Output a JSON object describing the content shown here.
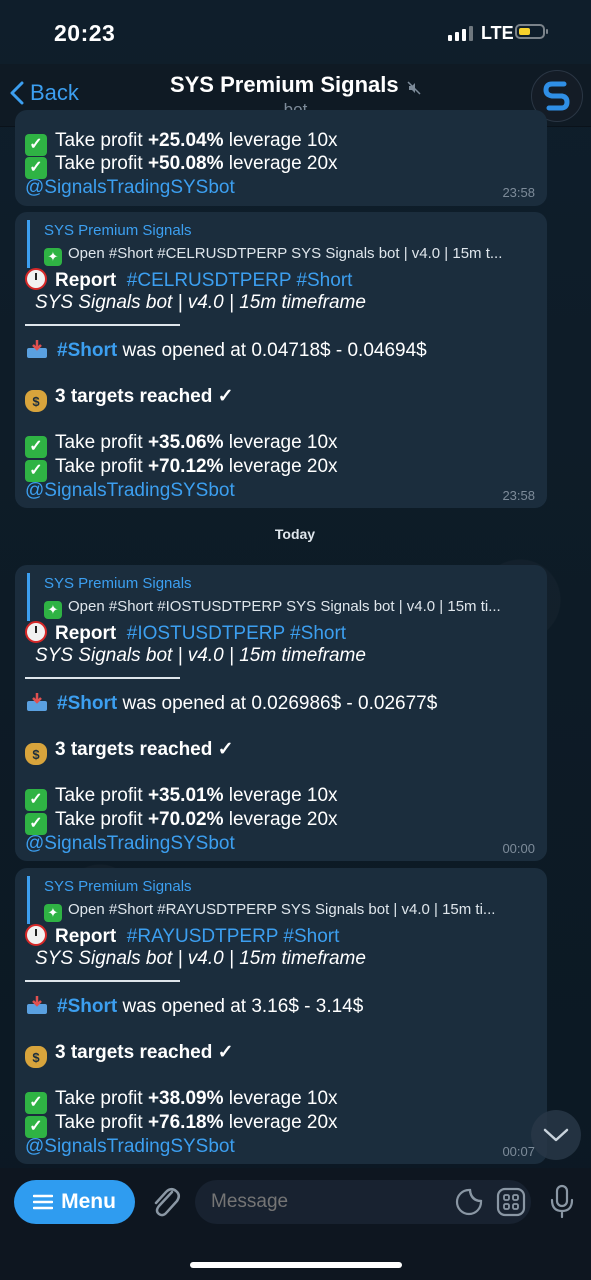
{
  "status_bar": {
    "time": "20:23",
    "network": "LTE"
  },
  "header": {
    "back_label": "Back",
    "title": "SYS Premium Signals",
    "subtitle": "bot"
  },
  "messages": [
    {
      "lines": [
        {
          "prefix": "Take profit ",
          "value": "+25.04%",
          "suffix": " leverage 10x"
        },
        {
          "prefix": "Take profit ",
          "value": "+50.08%",
          "suffix": " leverage 20x"
        }
      ],
      "mention": "@SignalsTradingSYSbot",
      "time": "23:58"
    },
    {
      "reply_name": "SYS Premium Signals",
      "reply_text": "Open #Short #CELRUSDTPERP    SYS Signals bot | v4.0 | 15m t...",
      "report_label": "Report",
      "report_tags": "#CELRUSDTPERP #Short",
      "subtitle": "SYS Signals bot | v4.0 | 15m timeframe",
      "open_tag": "#Short",
      "open_text": " was opened at 0.04718$ - 0.04694$",
      "targets": "3 targets reached ✓",
      "lines": [
        {
          "prefix": "Take profit ",
          "value": "+35.06%",
          "suffix": " leverage 10x"
        },
        {
          "prefix": "Take profit ",
          "value": "+70.12%",
          "suffix": " leverage 20x"
        }
      ],
      "mention": "@SignalsTradingSYSbot",
      "time": "23:58"
    },
    {
      "reply_name": "SYS Premium Signals",
      "reply_text": "Open #Short #IOSTUSDTPERP    SYS Signals bot | v4.0 | 15m ti...",
      "report_label": "Report",
      "report_tags": "#IOSTUSDTPERP #Short",
      "subtitle": "SYS Signals bot | v4.0 | 15m timeframe",
      "open_tag": "#Short",
      "open_text": " was opened at 0.026986$ - 0.02677$",
      "targets": "3 targets reached ✓",
      "lines": [
        {
          "prefix": "Take profit ",
          "value": "+35.01%",
          "suffix": " leverage 10x"
        },
        {
          "prefix": "Take profit ",
          "value": "+70.02%",
          "suffix": " leverage 20x"
        }
      ],
      "mention": "@SignalsTradingSYSbot",
      "time": "00:00"
    },
    {
      "reply_name": "SYS Premium Signals",
      "reply_text": "Open #Short #RAYUSDTPERP    SYS Signals bot | v4.0 | 15m ti...",
      "report_label": "Report",
      "report_tags": "#RAYUSDTPERP #Short",
      "subtitle": "SYS Signals bot | v4.0 | 15m timeframe",
      "open_tag": "#Short",
      "open_text": " was opened at 3.16$ - 3.14$",
      "targets": "3 targets reached ✓",
      "lines": [
        {
          "prefix": "Take profit ",
          "value": "+38.09%",
          "suffix": " leverage 10x"
        },
        {
          "prefix": "Take profit ",
          "value": "+76.18%",
          "suffix": " leverage 20x"
        }
      ],
      "mention": "@SignalsTradingSYSbot",
      "time": "00:07"
    }
  ],
  "date_separator": "Today",
  "composer": {
    "menu_label": "Menu",
    "placeholder": "Message"
  },
  "colors": {
    "accent": "#3c9ff0",
    "bubble": "#1b2d3d",
    "battery": "#f7d22c",
    "check": "#2fb344"
  }
}
